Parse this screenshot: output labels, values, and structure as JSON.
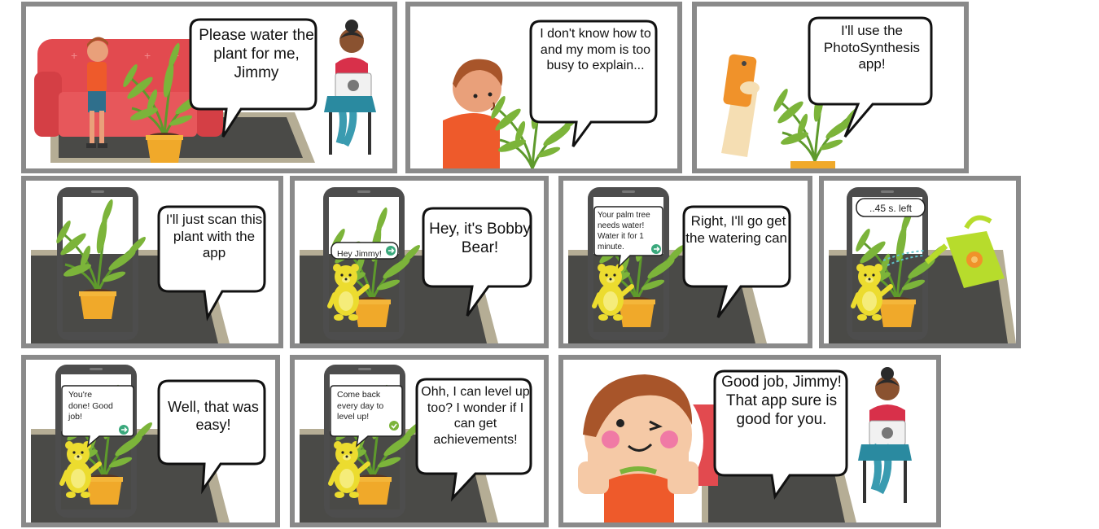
{
  "comic": {
    "panels": [
      {
        "id": "p1",
        "bubble": "Please water the plant for me, Jimmy"
      },
      {
        "id": "p2",
        "bubble": "I don't know how to and my mom is too busy to explain..."
      },
      {
        "id": "p3",
        "bubble": "I'll use the PhotoSynthesis app!"
      },
      {
        "id": "p4",
        "bubble": "I'll just scan this plant with the app"
      },
      {
        "id": "p5",
        "bubble": "Hey, it's Bobby Bear!",
        "phone_message": "Hey Jimmy!"
      },
      {
        "id": "p6",
        "bubble": "Right, I'll go get the watering can.",
        "phone_message": "Your palm tree needs water! Water it for 1 minute."
      },
      {
        "id": "p7",
        "phone_message": "..45 s. left"
      },
      {
        "id": "p8",
        "bubble": "Well, that was easy!",
        "phone_message": "You're done! Good job!"
      },
      {
        "id": "p9",
        "bubble": "Ohh, I can level up too? I wonder if I can get achievements!",
        "phone_message": "Come back every day to level up!"
      },
      {
        "id": "p10",
        "bubble": "Good job, Jimmy! That app sure is good for you."
      }
    ]
  },
  "colors": {
    "frame": "#8a8a8a",
    "rug": "#4a4a47",
    "rug_border": "#b5ad95",
    "sofa": "#e24a4f",
    "pot": "#f0a92a",
    "leaf": "#7cb43a",
    "phone": "#4d4d4d",
    "bear": "#ecdc2f",
    "mom_shirt": "#d8304a",
    "orange_shirt": "#ee5a2b",
    "watering_can": "#b7dc2c",
    "go_button": "#3aa87c"
  },
  "icons": [
    "arrow-right-icon",
    "check-icon",
    "heart-icon"
  ]
}
